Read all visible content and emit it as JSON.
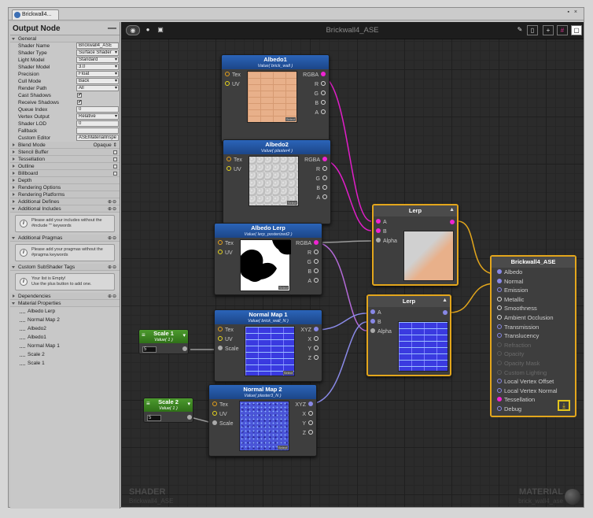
{
  "window": {
    "tab_title": "Brickwall4...",
    "controls": "▪ ×"
  },
  "left_panel": {
    "title": "Output Node",
    "general_label": "General",
    "props": [
      {
        "label": "Shader Name",
        "value": "Brickwall4_ASE",
        "kind": "text"
      },
      {
        "label": "Shader Type",
        "value": "Surface Shader",
        "kind": "dd"
      },
      {
        "label": "Light Model",
        "value": "Standard",
        "kind": "dd"
      },
      {
        "label": "Shader Model",
        "value": "3.0",
        "kind": "dd"
      },
      {
        "label": "Precision",
        "value": "Float",
        "kind": "dd"
      },
      {
        "label": "Cull Mode",
        "value": "Back",
        "kind": "dd"
      },
      {
        "label": "Render Path",
        "value": "All",
        "kind": "dd"
      },
      {
        "label": "Cast Shadows",
        "value": "✔",
        "kind": "check"
      },
      {
        "label": "Receive Shadows",
        "value": "✔",
        "kind": "check"
      },
      {
        "label": "Queue Index",
        "value": "0",
        "kind": "text"
      },
      {
        "label": "Vertex Output",
        "value": "Relative",
        "kind": "dd"
      },
      {
        "label": "Shader LOD",
        "value": "0",
        "kind": "text"
      },
      {
        "label": "Fallback",
        "value": "",
        "kind": "text"
      },
      {
        "label": "Custom Editor",
        "value": "ASEMaterialInspe",
        "kind": "text"
      }
    ],
    "sections": [
      {
        "label": "Blend Mode",
        "right": "Opaque ⇕"
      },
      {
        "label": "Stencil Buffer",
        "right": "box"
      },
      {
        "label": "Tessellation",
        "right": "box"
      },
      {
        "label": "Outline",
        "right": "box"
      },
      {
        "label": "Billboard",
        "right": "box"
      },
      {
        "label": "Depth",
        "right": ""
      },
      {
        "label": "Rendering Options",
        "right": ""
      },
      {
        "label": "Rendering Platforms",
        "right": ""
      },
      {
        "label": "Additional Defines",
        "right": "pm"
      }
    ],
    "includes": {
      "label": "Additional Includes",
      "info": "Please add your includes without the #include \"\" keywords"
    },
    "pragmas": {
      "label": "Additional Pragmas",
      "info": "Please add your pragmas without the #pragma keywords"
    },
    "subshader": {
      "label": "Custom SubShader Tags",
      "info_1": "Your list is Empty!",
      "info_2": "Use the plus button to add one."
    },
    "dependencies": "Dependencies",
    "material_properties": "Material Properties",
    "mat_props": [
      "Albedo Lerp",
      "Normal Map 2",
      "Albedo2",
      "Albedo1",
      "Normal Map 1",
      "Scale 2",
      "Scale 1"
    ],
    "pm": "⊕⊖"
  },
  "canvas": {
    "title": "Brickwall4_ASE",
    "toolbar_icons": [
      "brush-icon",
      "book-icon",
      "add-node-icon",
      "grid-icon",
      "maximize-icon"
    ],
    "watermark_left": {
      "title": "SHADER",
      "sub": "Brickwall4_ASE"
    },
    "watermark_right": {
      "title": "MATERIAL",
      "sub": "brick_wall4_ase"
    }
  },
  "nodes": {
    "albedo1": {
      "title": "Albedo1",
      "sub": "Value( brick_wall )",
      "in": [
        "Tex",
        "UV"
      ],
      "out": [
        "RGBA",
        "R",
        "G",
        "B",
        "A"
      ],
      "select": "Select"
    },
    "albedo2": {
      "title": "Albedo2",
      "sub": "Value( plaster4 )",
      "in": [
        "Tex",
        "UV"
      ],
      "out": [
        "RGBA",
        "R",
        "G",
        "B",
        "A"
      ],
      "select": "Select"
    },
    "albedo_lerp": {
      "title": "Albedo Lerp",
      "sub": "Value( lerp_posterized2 )",
      "in": [
        "Tex",
        "UV"
      ],
      "out": [
        "RGBA",
        "R",
        "G",
        "B",
        "A"
      ],
      "select": "Select"
    },
    "normal1": {
      "title": "Normal Map 1",
      "sub": "Value( brick_wall_N )",
      "in": [
        "Tex",
        "UV",
        "Scale"
      ],
      "out": [
        "XYZ",
        "X",
        "Y",
        "Z"
      ],
      "select": "Select"
    },
    "normal2": {
      "title": "Normal Map 2",
      "sub": "Value( plaster3_N )",
      "in": [
        "Tex",
        "UV",
        "Scale"
      ],
      "out": [
        "XYZ",
        "X",
        "Y",
        "Z"
      ],
      "select": "Select"
    },
    "lerp1": {
      "title": "Lerp",
      "in": [
        "A",
        "B",
        "Alpha"
      ]
    },
    "lerp2": {
      "title": "Lerp",
      "in": [
        "A",
        "B",
        "Alpha"
      ]
    },
    "scale1": {
      "title": "Scale 1",
      "sub": "Value( 1 )",
      "value": "5"
    },
    "scale2": {
      "title": "Scale 2",
      "sub": "Value( 1 )",
      "value": "5"
    },
    "output": {
      "title": "Brickwall4_ASE",
      "ports": [
        {
          "label": "Albedo",
          "type": "fillbl"
        },
        {
          "label": "Normal",
          "type": "fillbl"
        },
        {
          "label": "Emission",
          "type": "ringbl"
        },
        {
          "label": "Metallic",
          "type": "ring"
        },
        {
          "label": "Smoothness",
          "type": "ring"
        },
        {
          "label": "Ambient Occlusion",
          "type": "ring"
        },
        {
          "label": "Transmission",
          "type": "ringbl"
        },
        {
          "label": "Translucency",
          "type": "ringbl"
        },
        {
          "label": "Refraction",
          "type": "dim"
        },
        {
          "label": "Opacity",
          "type": "dim"
        },
        {
          "label": "Opacity Mask",
          "type": "dim"
        },
        {
          "label": "Custom Lighting",
          "type": "dim"
        },
        {
          "label": "Local Vertex Offset",
          "type": "ringbl"
        },
        {
          "label": "Local Vertex Normal",
          "type": "ringbl"
        },
        {
          "label": "Tessellation",
          "type": "fillmg"
        },
        {
          "label": "Debug",
          "type": "ringbl"
        }
      ]
    }
  },
  "colors": {
    "node_header": "#2b64b8",
    "selected_border": "#e3a61c",
    "wire_rgba": "#e01ec8",
    "wire_xyz": "#8a8ae8",
    "wire_float": "#9a9a9a",
    "value_header": "#3f8a25"
  }
}
